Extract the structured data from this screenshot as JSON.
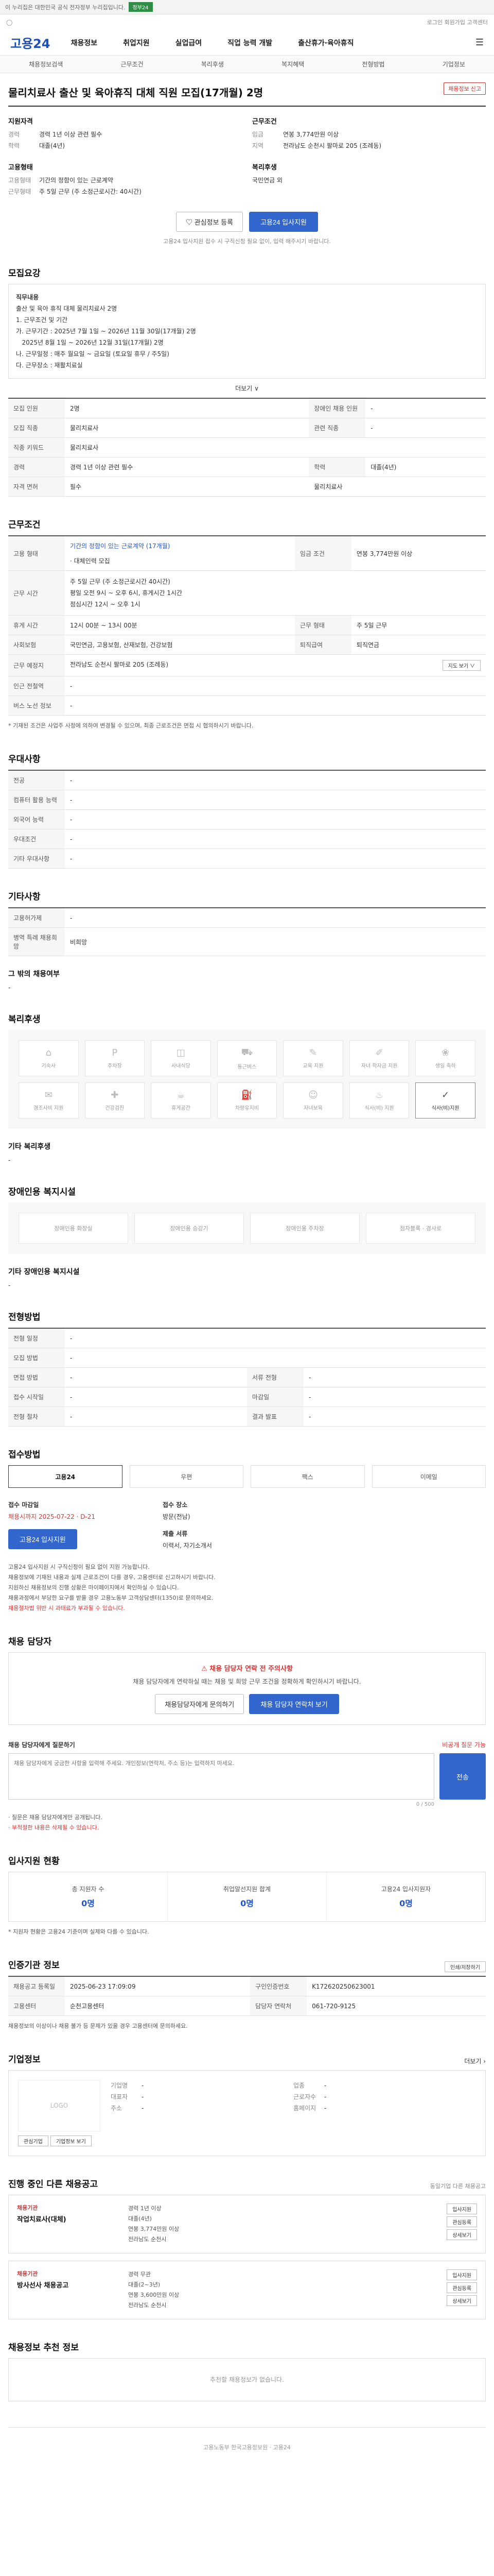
{
  "topbar": {
    "text": "이 누리집은 대한민국 공식 전자정부 누리집입니다.",
    "badge": "정부24"
  },
  "util": {
    "left": "◯",
    "right": "로그인   회원가입   고객센터"
  },
  "header": {
    "logo": "고용24",
    "gnb": [
      "채용정보",
      "취업지원",
      "실업급여",
      "직업 능력 개발",
      "출산휴가·육아휴직"
    ]
  },
  "subnav": [
    "채용정보검색",
    "근무조건",
    "복리후생",
    "복지혜택",
    "전형방법",
    "기업정보"
  ],
  "job": {
    "title": "물리치료사 출산 및 육아휴직 대체 직원 모집(17개월) 2명",
    "report_btn": "채용정보 신고",
    "applicant_h": "지원자격",
    "applicant": [
      {
        "k": "경력",
        "v": "경력 1년 이상 관련 필수"
      },
      {
        "k": "학력",
        "v": "대졸(4년)"
      }
    ],
    "employ_h": "고용형태",
    "employ": [
      {
        "k": "고용형태",
        "v": "기간의 정함이 있는 근로계약"
      },
      {
        "k": "근무형태",
        "v": "주 5일 근무 (주 소정근로시간: 40시간)"
      }
    ],
    "work_h": "근무조건",
    "work": [
      {
        "k": "임금",
        "v": "연봉 3,774만원 이상"
      },
      {
        "k": "지역",
        "v": "전라남도 순천시 팔마로 205 (조례동)"
      }
    ],
    "welfare_h": "복리후생",
    "welfare": [
      {
        "k": "",
        "v": "국민연금 외"
      }
    ]
  },
  "buttons": {
    "scrap": "관심정보 등록",
    "apply": "고용24 입사지원"
  },
  "apply_note": "고용24 입사지원 접수 시 구직신청 필요 없이, 입력 해주시기 바랍니다.",
  "recruit": {
    "title": "모집요강",
    "duty_h": "직무내용",
    "duty": [
      "출산 및 육아 휴직 대체 물리치료사 2명",
      "1. 근무조건 및 기간",
      "가. 근무기간 : 2025년 7월 1일 ~ 2026년 11월 30일(17개월) 2명",
      "   2025년 8월 1일 ~ 2026년 12월 31일(17개월) 2명",
      "나. 근무일정 : 매주 월요일 ~ 금요일 (토요일 휴무 / 주5일)",
      "다. 근무장소 : 재활치료실"
    ],
    "more": "더보기 ∨",
    "rows": [
      {
        "k": "모집 인원",
        "v": "2명",
        "k2": "장애인 채용 인원",
        "v2": "-"
      },
      {
        "k": "모집 직종",
        "v": "물리치료사",
        "k2": "관련 직종",
        "v2": "-"
      },
      {
        "k": "직종 키워드",
        "v": "물리치료사",
        "k2": "",
        "v2": ""
      },
      {
        "k": "경력",
        "v": "경력 1년 이상 관련 필수",
        "k2": "학력",
        "v2": "대졸(4년)"
      },
      {
        "k": "자격 면허",
        "v": "필수",
        "k2": "물리치료사",
        "v2": ""
      }
    ]
  },
  "conditions": {
    "title": "근무조건",
    "wage_k": "고용 형태",
    "wage_v": "기간의 정함이 있는 근로계약 (17개월)",
    "wage_sub": "· 대체인력 모집",
    "pay_k": "임금 조건",
    "pay_v": "연봉 3,774만원 이상",
    "hours_k": "근무 시간",
    "hours_v": "주 5일 근무 (주 소정근로시간 40시간)",
    "hours_sub1": "평일 오전 9시 ~ 오후 6시, 휴게시간 1시간",
    "hours_sub2": "점심시간 12시 ~ 오후 1시",
    "rows": [
      {
        "k": "휴게 시간",
        "v": "12시 00분 ~ 13시 00분",
        "k2": "근무 형태",
        "v2": "주 5일 근무"
      },
      {
        "k": "사회보험",
        "v": "국민연금, 고용보험, 산재보험, 건강보험",
        "k2": "퇴직급여",
        "v2": "퇴직연금"
      },
      {
        "k": "근무 예정지",
        "v": "전라남도 순천시 팔마로 205 (조례동)",
        "k2": "",
        "v2": ""
      },
      {
        "k": "인근 전철역",
        "v": "-",
        "k2": "",
        "v2": ""
      },
      {
        "k": "버스 노선 정보",
        "v": "-",
        "k2": "",
        "v2": ""
      }
    ],
    "map_btn": "지도 보기 ∨",
    "note": "* 기재된 조건은 사업주 사정에 의하여 변경될 수 있으며, 최종 근로조건은 면접 시 협의하시기 바랍니다."
  },
  "prefer": {
    "title": "우대사항",
    "rows": [
      {
        "k": "전공",
        "v": "-"
      },
      {
        "k": "컴퓨터 활용 능력",
        "v": "-"
      },
      {
        "k": "외국어 능력",
        "v": "-"
      },
      {
        "k": "우대조건",
        "v": "-"
      },
      {
        "k": "기타 우대사항",
        "v": "-"
      }
    ]
  },
  "etc": {
    "title": "기타사항",
    "rows": [
      {
        "k": "고용허가제",
        "v": "-"
      },
      {
        "k": "병역 특례 채용희망",
        "v": "비희망"
      }
    ],
    "extra_k": "그 밖의 채용여부",
    "extra_v": "-"
  },
  "welfare": {
    "title": "복리후생",
    "items": [
      "기숙사",
      "주차장",
      "사내식당",
      "통근버스",
      "교육 지원",
      "자녀 학자금 지원",
      "생일 축하",
      "경조사비 지원",
      "건강검진",
      "휴게공간",
      "차량유지비",
      "자녀보육",
      "식사(비) 지원",
      ""
    ],
    "active_index": 13,
    "active_label": "식사(비)지원",
    "etc_k": "기타 복리후생",
    "etc_v": "-"
  },
  "disab": {
    "title": "장애인용 복지시설",
    "items": [
      "장애인용 화장실",
      "장애인용 승강기",
      "장애인용 주차장",
      "점자블록 · 경사로"
    ],
    "etc_k": "기타 장애인용 복지시설",
    "etc_v": "-"
  },
  "selection": {
    "title": "전형방법",
    "rows": [
      {
        "k": "전형 일정",
        "v": "-"
      },
      {
        "k": "모집 방법",
        "v": "-"
      },
      {
        "k": "면접 방법",
        "v": "-",
        "k2": "서류 전형",
        "v2": "-"
      },
      {
        "k": "접수 시작일",
        "v": "-",
        "k2": "마감일",
        "v2": "-"
      },
      {
        "k": "전형 절차",
        "v": "-",
        "k2": "결과 발표",
        "v2": "-"
      }
    ]
  },
  "receipt": {
    "title": "접수방법",
    "items": [
      "고용24",
      "우편",
      "팩스",
      "이메일"
    ],
    "active": 0,
    "period_h": "접수 마감일",
    "period_v": "채용시까지 2025-07-22 · D-21",
    "contact_h": "접수 장소",
    "contact_v": "방문(전남)",
    "apply": "고용24 입사지원",
    "docs_h": "제출 서류",
    "docs_v": "이력서, 자기소개서",
    "notes": [
      "고용24 입사지원 시 구직신청이 필요 없이 지원 가능합니다.",
      "채용정보에 기재된 내용과 실제 근로조건이 다를 경우, 고용센터로 신고하시기 바랍니다.",
      "지원하신 채용정보의 진행 상황은 마이페이지에서 확인하실 수 있습니다.",
      "채용과정에서 부당한 요구를 받을 경우 고용노동부 고객상담센터(1350)로 문의하세요."
    ],
    "red_note": "채용절차법 위반 시 과태료가 부과될 수 있습니다."
  },
  "contact": {
    "title": "채용 담당자",
    "warn": "채용 담당자 연락 전 주의사항",
    "warn_sub": "채용 담당자에게 연락하실 때는 채용 및 희망 근무 조건을 정확하게 확인하시기 바랍니다.",
    "btn1": "채용담당자에게 문의하기",
    "btn2": "채용 담당자 연락처 보기",
    "ask_h": "채용 담당자에게 질문하기",
    "ask_note": "비공개 질문 가능",
    "ask_placeholder": "채용 담당자에게 궁금한 사항을 입력해 주세요. 개인정보(연락처, 주소 등)는 입력하지 마세요.",
    "ask_count": "0 / 500",
    "ask_btn": "전송",
    "ask_foot1": "· 질문은 채용 담당자에게만 공개됩니다.",
    "ask_foot2": "· 부적절한 내용은 삭제될 수 있습니다."
  },
  "status": {
    "title": "입사지원 현황",
    "items": [
      {
        "l": "총 지원자 수",
        "n": "0명"
      },
      {
        "l": "취업알선지원 합계",
        "n": "0명"
      },
      {
        "l": "고용24 입사지원자",
        "n": "0명"
      }
    ],
    "note": "* 지원자 현황은 고용24 기준이며 실제와 다를 수 있습니다."
  },
  "info": {
    "title": "인증기관 정보",
    "print": "인쇄/저장하기",
    "rows": [
      {
        "k": "채용공고 등록일",
        "v": "2025-06-23 17:09:09",
        "k2": "구인인증번호",
        "v2": "K172620250623001"
      },
      {
        "k": "고용센터",
        "v": "순천고용센터",
        "k2": "담당자 연락처",
        "v2": "061-720-9125"
      }
    ],
    "note": "채용정보의 이상이나 채용 불가 등 문제가 있을 경우 고용센터에 문의하세요."
  },
  "company": {
    "title": "기업정보",
    "more": "더보기 ›",
    "logo": "LOGO",
    "btn1": "관심기업",
    "btn2": "기업정보 보기",
    "rows": [
      {
        "k": "기업명",
        "v": "-",
        "k2": "업종",
        "v2": "-"
      },
      {
        "k": "대표자",
        "v": "-",
        "k2": "근로자수",
        "v2": "-"
      },
      {
        "k": "주소",
        "v": "-",
        "k2": "홈페이지",
        "v2": "-"
      }
    ]
  },
  "related": {
    "title": "진행 중인 다른 채용공고",
    "note": "동일기업 다른 채용공고",
    "items": [
      {
        "co": "채용기관",
        "title": "작업치료사(대체)",
        "l1": "경력 1년 이상",
        "l2": "대졸(4년)",
        "l3": "연봉 3,774만원 이상",
        "l4": "전라남도 순천시"
      },
      {
        "co": "채용기관",
        "title": "방사선사 채용공고",
        "l1": "경력 무관",
        "l2": "대졸(2~3년)",
        "l3": "연봉 3,600만원 이상",
        "l4": "전라남도 순천시"
      }
    ],
    "btn_apply": "입사지원",
    "btn_scrap": "관심등록",
    "btn_view": "상세보기"
  },
  "recommend": {
    "title": "채용정보 추천 정보",
    "note": "추천할 채용정보가 없습니다."
  },
  "footer": {
    "text": "고용노동부 한국고용정보원 · 고용24"
  }
}
